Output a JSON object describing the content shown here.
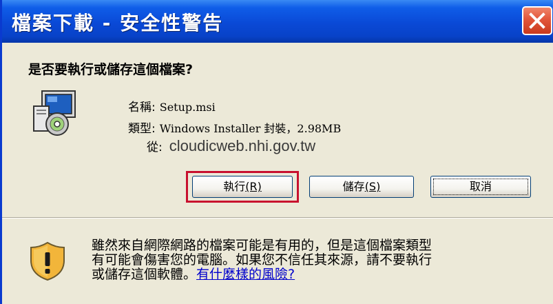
{
  "window": {
    "title": "檔案下載 - 安全性警告"
  },
  "dialog": {
    "question": "是否要執行或儲存這個檔案?",
    "file": {
      "name_label": "名稱:",
      "name_value": "Setup.msi",
      "type_label": "類型:",
      "type_value": "Windows Installer 封裝，2.98MB",
      "from_label": "從:",
      "from_value": "cloudicweb.nhi.gov.tw"
    },
    "buttons": {
      "run_label": "執行",
      "run_accel": "(R)",
      "save_label": "儲存",
      "save_accel": "(S)",
      "cancel_label": "取消"
    },
    "warning": {
      "line1": "雖然來自網際網路的檔案可能是有用的，但是這個檔案類型",
      "line2": "有可能會傷害您的電腦。如果您不信任其來源，請不要執行",
      "line3": "或儲存這個軟體。",
      "link": "有什麼樣的風險?"
    }
  },
  "colors": {
    "titlebar": "#0A49D6",
    "window_bg": "#ECE9D8",
    "close_button": "#E2553A",
    "highlight": "#C8102E",
    "link": "#0000CC"
  },
  "icons": {
    "close": "close-icon",
    "file": "msi-installer-icon",
    "shield": "warning-shield-icon"
  }
}
